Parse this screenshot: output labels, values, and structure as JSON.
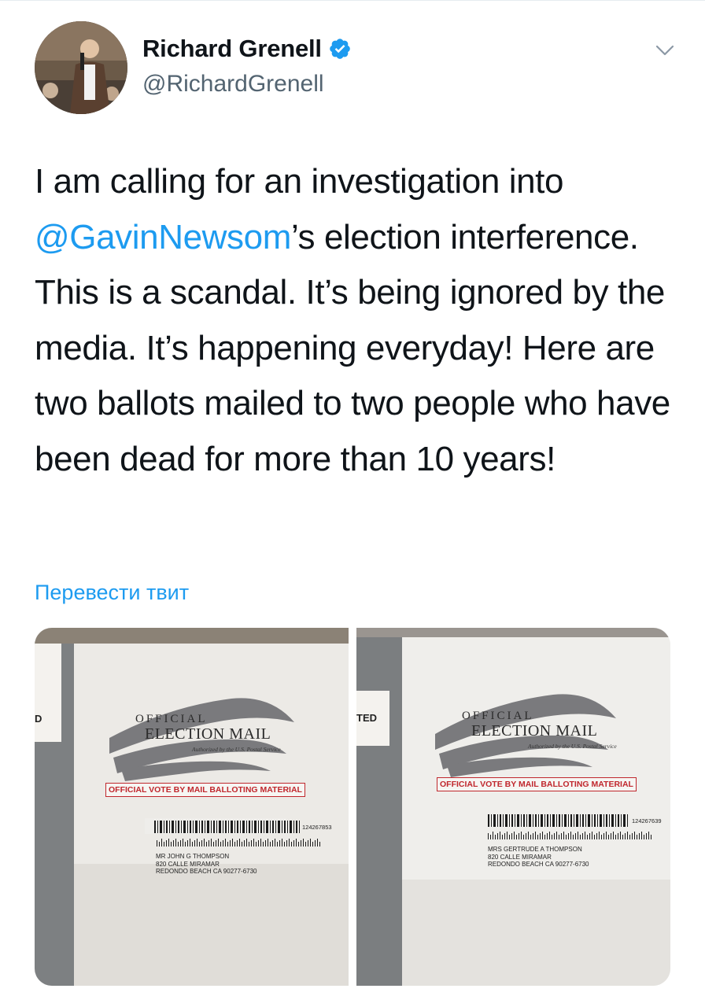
{
  "tweet": {
    "author_name": "Richard Grenell",
    "author_handle": "@RichardGrenell",
    "verified_icon": "verified-badge-icon",
    "menu_icon": "chevron-down-icon",
    "text_before": "I am calling for an investigation into ",
    "mention": "@GavinNewsom",
    "text_after": "’s election interference. This is a scandal. It’s being ignored by the media. It’s happening everyday! Here are two ballots mailed to two people who have been dead for more than 10 years!",
    "translate_label": "Перевести твит"
  },
  "colors": {
    "link": "#1d9bf0",
    "text": "#0f1419",
    "secondary": "#536471",
    "stamp_red": "#c0272d"
  },
  "media": {
    "photos": [
      {
        "edge_tag": "D",
        "stamp_official": "OFFICIAL",
        "stamp_election": "ELECTION MAIL",
        "stamp_authorized": "Authorized by the U.S. Postal Service",
        "vote_label": "OFFICIAL VOTE BY MAIL BALLOTING MATERIAL",
        "barcode_number": "124267853",
        "address_line1": "MR JOHN G THOMPSON",
        "address_line2": "820 CALLE MIRAMAR",
        "address_line3": "REDONDO BEACH CA 90277-6730"
      },
      {
        "edge_tag": "TED",
        "stamp_official": "OFFICIAL",
        "stamp_election": "ELECTION MAIL",
        "stamp_authorized": "Authorized by the U.S. Postal Service",
        "vote_label": "OFFICIAL VOTE BY MAIL BALLOTING MATERIAL",
        "barcode_number": "124267639",
        "address_line1": "MRS GERTRUDE A THOMPSON",
        "address_line2": "820 CALLE MIRAMAR",
        "address_line3": "REDONDO BEACH CA 90277-6730"
      }
    ]
  }
}
